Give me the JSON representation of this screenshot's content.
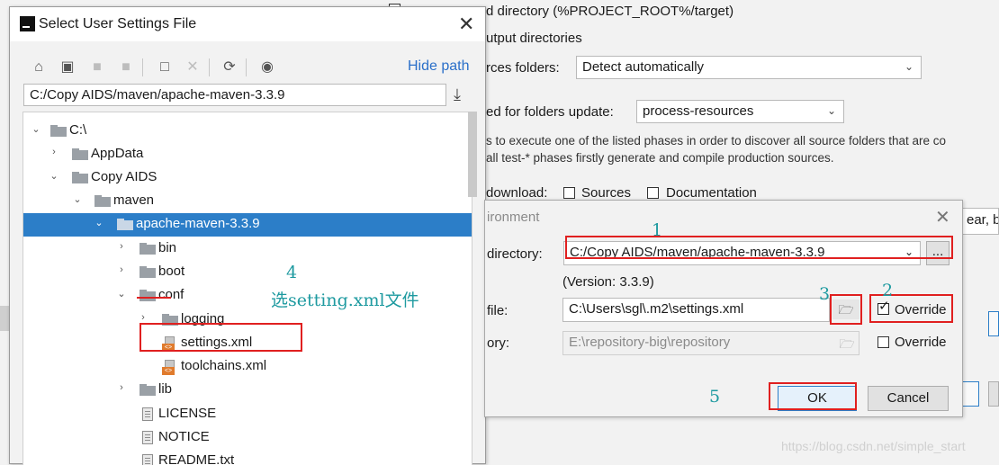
{
  "background": {
    "line1": "d directory (%PROJECT_ROOT%/target)",
    "line2": "utput directories",
    "sources_label": "rces folders:",
    "sources_value": "Detect automatically",
    "phase_label": "ed for folders update:",
    "phase_value": "process-resources",
    "hint1": "s to execute one of the listed phases in order to discover all source folders that are co",
    "hint2": "all test-* phases firstly generate and compile production sources.",
    "download_label": "download:",
    "sources_chk": "Sources",
    "documentation_chk": "Documentation",
    "right_field_text": "ear, b"
  },
  "chooser": {
    "title": "Select User Settings File",
    "hide_path": "Hide path",
    "path_value": "C:/Copy AIDS/maven/apache-maven-3.3.9",
    "tree": [
      {
        "label": "C:\\",
        "icon": "folder-icon"
      },
      {
        "label": "AppData",
        "icon": "folder-icon"
      },
      {
        "label": "Copy AIDS",
        "icon": "folder-icon"
      },
      {
        "label": "maven",
        "icon": "folder-icon"
      },
      {
        "label": "apache-maven-3.3.9",
        "icon": "folder-icon"
      },
      {
        "label": "bin",
        "icon": "folder-icon"
      },
      {
        "label": "boot",
        "icon": "folder-icon"
      },
      {
        "label": "conf",
        "icon": "folder-icon"
      },
      {
        "label": "logging",
        "icon": "folder-icon"
      },
      {
        "label": "settings.xml",
        "icon": "xml-file-icon"
      },
      {
        "label": "toolchains.xml",
        "icon": "xml-file-icon"
      },
      {
        "label": "lib",
        "icon": "folder-icon"
      },
      {
        "label": "LICENSE",
        "icon": "text-file-icon"
      },
      {
        "label": "NOTICE",
        "icon": "text-file-icon"
      },
      {
        "label": "README.txt",
        "icon": "text-file-icon"
      }
    ]
  },
  "env": {
    "title": "ironment",
    "home_label": "directory:",
    "home_value": "C:/Copy AIDS/maven/apache-maven-3.3.9",
    "browse_label": "...",
    "version": "(Version: 3.3.9)",
    "settings_label": "file:",
    "settings_value": "C:\\Users\\sgl\\.m2\\settings.xml",
    "override_label": "Override",
    "repo_label": "ory:",
    "repo_value": "E:\\repository-big\\repository",
    "override2_label": "Override",
    "ok": "OK",
    "cancel": "Cancel"
  },
  "annotations": {
    "n1": "1",
    "n2": "2",
    "n3": "3",
    "n4": "4",
    "n5": "5",
    "instruction": "选setting.xml文件"
  },
  "watermark": "https://blog.csdn.net/simple_start",
  "colors": {
    "selection": "#2c7ec8",
    "annotation": "#1e9aa0",
    "highlight": "#e02020",
    "link": "#2a6fc9"
  }
}
